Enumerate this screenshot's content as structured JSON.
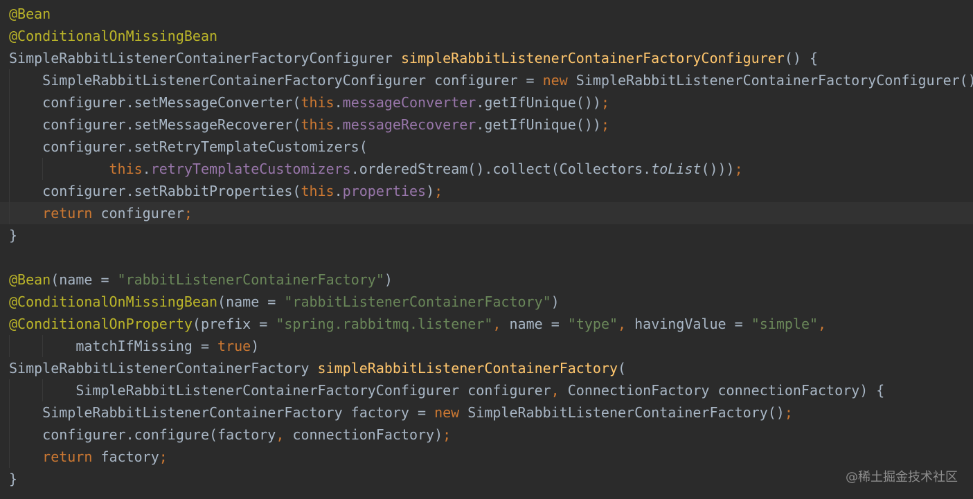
{
  "editor": {
    "theme": "Darcula",
    "background": "#2b2b2b",
    "current_line_background": "#323232",
    "colors": {
      "annotation": "#bbb529",
      "keyword": "#cc7832",
      "method_declaration": "#ffc66d",
      "field": "#9876aa",
      "string": "#6a8759",
      "default_text": "#a9b7c6"
    },
    "current_line_index": 9,
    "lines": [
      [
        {
          "t": "@Bean",
          "k": "ann"
        }
      ],
      [
        {
          "t": "@ConditionalOnMissingBean",
          "k": "ann"
        }
      ],
      [
        {
          "t": "SimpleRabbitListenerContainerFactoryConfigurer ",
          "k": "plain"
        },
        {
          "t": "simpleRabbitListenerContainerFactoryConfigurer",
          "k": "fn"
        },
        {
          "t": "() {",
          "k": "plain"
        }
      ],
      [
        {
          "t": "    SimpleRabbitListenerContainerFactoryConfigurer configurer = ",
          "k": "plain"
        },
        {
          "t": "new",
          "k": "kw"
        },
        {
          "t": " SimpleRabbitListenerContainerFactoryConfigurer()",
          "k": "plain"
        }
      ],
      [
        {
          "t": "    configurer.setMessageConverter(",
          "k": "plain"
        },
        {
          "t": "this",
          "k": "kw"
        },
        {
          "t": ".",
          "k": "plain"
        },
        {
          "t": "messageConverter",
          "k": "field"
        },
        {
          "t": ".getIfUnique())",
          "k": "plain"
        },
        {
          "t": ";",
          "k": "punct"
        }
      ],
      [
        {
          "t": "    configurer.setMessageRecoverer(",
          "k": "plain"
        },
        {
          "t": "this",
          "k": "kw"
        },
        {
          "t": ".",
          "k": "plain"
        },
        {
          "t": "messageRecoverer",
          "k": "field"
        },
        {
          "t": ".getIfUnique())",
          "k": "plain"
        },
        {
          "t": ";",
          "k": "punct"
        }
      ],
      [
        {
          "t": "    configurer.setRetryTemplateCustomizers(",
          "k": "plain"
        }
      ],
      [
        {
          "t": "            ",
          "k": "plain"
        },
        {
          "t": "this",
          "k": "kw"
        },
        {
          "t": ".",
          "k": "plain"
        },
        {
          "t": "retryTemplateCustomizers",
          "k": "field"
        },
        {
          "t": ".orderedStream().collect(Collectors.",
          "k": "plain"
        },
        {
          "t": "toList",
          "k": "static"
        },
        {
          "t": "()))",
          "k": "plain"
        },
        {
          "t": ";",
          "k": "punct"
        }
      ],
      [
        {
          "t": "    configurer.setRabbitProperties(",
          "k": "plain"
        },
        {
          "t": "this",
          "k": "kw"
        },
        {
          "t": ".",
          "k": "plain"
        },
        {
          "t": "properties",
          "k": "field"
        },
        {
          "t": ")",
          "k": "plain"
        },
        {
          "t": ";",
          "k": "punct"
        }
      ],
      [
        {
          "t": "    ",
          "k": "plain"
        },
        {
          "t": "return",
          "k": "kw"
        },
        {
          "t": " configurer",
          "k": "plain"
        },
        {
          "t": ";",
          "k": "punct"
        }
      ],
      [
        {
          "t": "}",
          "k": "plain"
        }
      ],
      [],
      [
        {
          "t": "@Bean",
          "k": "ann"
        },
        {
          "t": "(name = ",
          "k": "plain"
        },
        {
          "t": "\"rabbitListenerContainerFactory\"",
          "k": "str"
        },
        {
          "t": ")",
          "k": "plain"
        }
      ],
      [
        {
          "t": "@ConditionalOnMissingBean",
          "k": "ann"
        },
        {
          "t": "(name = ",
          "k": "plain"
        },
        {
          "t": "\"rabbitListenerContainerFactory\"",
          "k": "str"
        },
        {
          "t": ")",
          "k": "plain"
        }
      ],
      [
        {
          "t": "@ConditionalOnProperty",
          "k": "ann"
        },
        {
          "t": "(prefix = ",
          "k": "plain"
        },
        {
          "t": "\"spring.rabbitmq.listener\"",
          "k": "str"
        },
        {
          "t": ",",
          "k": "punct"
        },
        {
          "t": " name = ",
          "k": "plain"
        },
        {
          "t": "\"type\"",
          "k": "str"
        },
        {
          "t": ",",
          "k": "punct"
        },
        {
          "t": " havingValue = ",
          "k": "plain"
        },
        {
          "t": "\"simple\"",
          "k": "str"
        },
        {
          "t": ",",
          "k": "punct"
        }
      ],
      [
        {
          "t": "        matchIfMissing = ",
          "k": "plain"
        },
        {
          "t": "true",
          "k": "kw"
        },
        {
          "t": ")",
          "k": "plain"
        }
      ],
      [
        {
          "t": "SimpleRabbitListenerContainerFactory ",
          "k": "plain"
        },
        {
          "t": "simpleRabbitListenerContainerFactory",
          "k": "fn"
        },
        {
          "t": "(",
          "k": "plain"
        }
      ],
      [
        {
          "t": "        SimpleRabbitListenerContainerFactoryConfigurer configurer",
          "k": "plain"
        },
        {
          "t": ",",
          "k": "punct"
        },
        {
          "t": " ConnectionFactory connectionFactory) {",
          "k": "plain"
        }
      ],
      [
        {
          "t": "    SimpleRabbitListenerContainerFactory factory = ",
          "k": "plain"
        },
        {
          "t": "new",
          "k": "kw"
        },
        {
          "t": " SimpleRabbitListenerContainerFactory()",
          "k": "plain"
        },
        {
          "t": ";",
          "k": "punct"
        }
      ],
      [
        {
          "t": "    configurer.configure(factory",
          "k": "plain"
        },
        {
          "t": ",",
          "k": "punct"
        },
        {
          "t": " connectionFactory)",
          "k": "plain"
        },
        {
          "t": ";",
          "k": "punct"
        }
      ],
      [
        {
          "t": "    ",
          "k": "plain"
        },
        {
          "t": "return",
          "k": "kw"
        },
        {
          "t": " factory",
          "k": "plain"
        },
        {
          "t": ";",
          "k": "punct"
        }
      ],
      [
        {
          "t": "}",
          "k": "plain"
        }
      ]
    ]
  },
  "watermark": {
    "text": "@稀土掘金技术社区"
  }
}
